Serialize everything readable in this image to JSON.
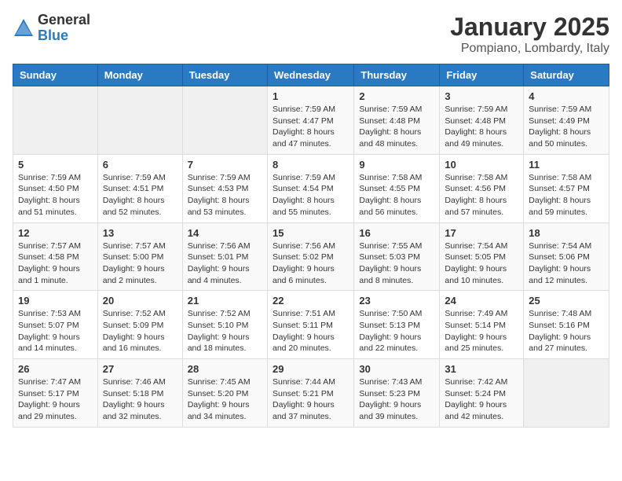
{
  "header": {
    "logo_general": "General",
    "logo_blue": "Blue",
    "month": "January 2025",
    "location": "Pompiano, Lombardy, Italy"
  },
  "days_of_week": [
    "Sunday",
    "Monday",
    "Tuesday",
    "Wednesday",
    "Thursday",
    "Friday",
    "Saturday"
  ],
  "weeks": [
    [
      {
        "day": "",
        "info": ""
      },
      {
        "day": "",
        "info": ""
      },
      {
        "day": "",
        "info": ""
      },
      {
        "day": "1",
        "info": "Sunrise: 7:59 AM\nSunset: 4:47 PM\nDaylight: 8 hours and 47 minutes."
      },
      {
        "day": "2",
        "info": "Sunrise: 7:59 AM\nSunset: 4:48 PM\nDaylight: 8 hours and 48 minutes."
      },
      {
        "day": "3",
        "info": "Sunrise: 7:59 AM\nSunset: 4:48 PM\nDaylight: 8 hours and 49 minutes."
      },
      {
        "day": "4",
        "info": "Sunrise: 7:59 AM\nSunset: 4:49 PM\nDaylight: 8 hours and 50 minutes."
      }
    ],
    [
      {
        "day": "5",
        "info": "Sunrise: 7:59 AM\nSunset: 4:50 PM\nDaylight: 8 hours and 51 minutes."
      },
      {
        "day": "6",
        "info": "Sunrise: 7:59 AM\nSunset: 4:51 PM\nDaylight: 8 hours and 52 minutes."
      },
      {
        "day": "7",
        "info": "Sunrise: 7:59 AM\nSunset: 4:53 PM\nDaylight: 8 hours and 53 minutes."
      },
      {
        "day": "8",
        "info": "Sunrise: 7:59 AM\nSunset: 4:54 PM\nDaylight: 8 hours and 55 minutes."
      },
      {
        "day": "9",
        "info": "Sunrise: 7:58 AM\nSunset: 4:55 PM\nDaylight: 8 hours and 56 minutes."
      },
      {
        "day": "10",
        "info": "Sunrise: 7:58 AM\nSunset: 4:56 PM\nDaylight: 8 hours and 57 minutes."
      },
      {
        "day": "11",
        "info": "Sunrise: 7:58 AM\nSunset: 4:57 PM\nDaylight: 8 hours and 59 minutes."
      }
    ],
    [
      {
        "day": "12",
        "info": "Sunrise: 7:57 AM\nSunset: 4:58 PM\nDaylight: 9 hours and 1 minute."
      },
      {
        "day": "13",
        "info": "Sunrise: 7:57 AM\nSunset: 5:00 PM\nDaylight: 9 hours and 2 minutes."
      },
      {
        "day": "14",
        "info": "Sunrise: 7:56 AM\nSunset: 5:01 PM\nDaylight: 9 hours and 4 minutes."
      },
      {
        "day": "15",
        "info": "Sunrise: 7:56 AM\nSunset: 5:02 PM\nDaylight: 9 hours and 6 minutes."
      },
      {
        "day": "16",
        "info": "Sunrise: 7:55 AM\nSunset: 5:03 PM\nDaylight: 9 hours and 8 minutes."
      },
      {
        "day": "17",
        "info": "Sunrise: 7:54 AM\nSunset: 5:05 PM\nDaylight: 9 hours and 10 minutes."
      },
      {
        "day": "18",
        "info": "Sunrise: 7:54 AM\nSunset: 5:06 PM\nDaylight: 9 hours and 12 minutes."
      }
    ],
    [
      {
        "day": "19",
        "info": "Sunrise: 7:53 AM\nSunset: 5:07 PM\nDaylight: 9 hours and 14 minutes."
      },
      {
        "day": "20",
        "info": "Sunrise: 7:52 AM\nSunset: 5:09 PM\nDaylight: 9 hours and 16 minutes."
      },
      {
        "day": "21",
        "info": "Sunrise: 7:52 AM\nSunset: 5:10 PM\nDaylight: 9 hours and 18 minutes."
      },
      {
        "day": "22",
        "info": "Sunrise: 7:51 AM\nSunset: 5:11 PM\nDaylight: 9 hours and 20 minutes."
      },
      {
        "day": "23",
        "info": "Sunrise: 7:50 AM\nSunset: 5:13 PM\nDaylight: 9 hours and 22 minutes."
      },
      {
        "day": "24",
        "info": "Sunrise: 7:49 AM\nSunset: 5:14 PM\nDaylight: 9 hours and 25 minutes."
      },
      {
        "day": "25",
        "info": "Sunrise: 7:48 AM\nSunset: 5:16 PM\nDaylight: 9 hours and 27 minutes."
      }
    ],
    [
      {
        "day": "26",
        "info": "Sunrise: 7:47 AM\nSunset: 5:17 PM\nDaylight: 9 hours and 29 minutes."
      },
      {
        "day": "27",
        "info": "Sunrise: 7:46 AM\nSunset: 5:18 PM\nDaylight: 9 hours and 32 minutes."
      },
      {
        "day": "28",
        "info": "Sunrise: 7:45 AM\nSunset: 5:20 PM\nDaylight: 9 hours and 34 minutes."
      },
      {
        "day": "29",
        "info": "Sunrise: 7:44 AM\nSunset: 5:21 PM\nDaylight: 9 hours and 37 minutes."
      },
      {
        "day": "30",
        "info": "Sunrise: 7:43 AM\nSunset: 5:23 PM\nDaylight: 9 hours and 39 minutes."
      },
      {
        "day": "31",
        "info": "Sunrise: 7:42 AM\nSunset: 5:24 PM\nDaylight: 9 hours and 42 minutes."
      },
      {
        "day": "",
        "info": ""
      }
    ]
  ]
}
